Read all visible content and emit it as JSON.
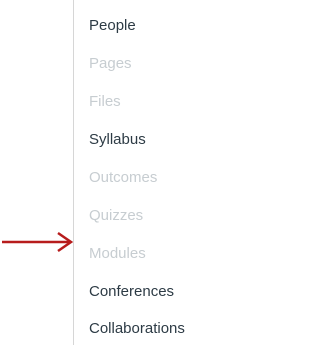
{
  "course_nav": {
    "items": [
      {
        "label": "People",
        "enabled": true
      },
      {
        "label": "Pages",
        "enabled": false
      },
      {
        "label": "Files",
        "enabled": false
      },
      {
        "label": "Syllabus",
        "enabled": true
      },
      {
        "label": "Outcomes",
        "enabled": false
      },
      {
        "label": "Quizzes",
        "enabled": false
      },
      {
        "label": "Modules",
        "enabled": false
      },
      {
        "label": "Conferences",
        "enabled": true
      },
      {
        "label": "Collaborations",
        "enabled": true
      }
    ]
  },
  "annotation": {
    "icon": "right-arrow-icon",
    "points_to": "Modules",
    "color": "#b71c1c"
  },
  "colors": {
    "enabled_text": "#2d3b45",
    "disabled_text": "#c7cdd1",
    "divider": "#d6d6d6"
  }
}
